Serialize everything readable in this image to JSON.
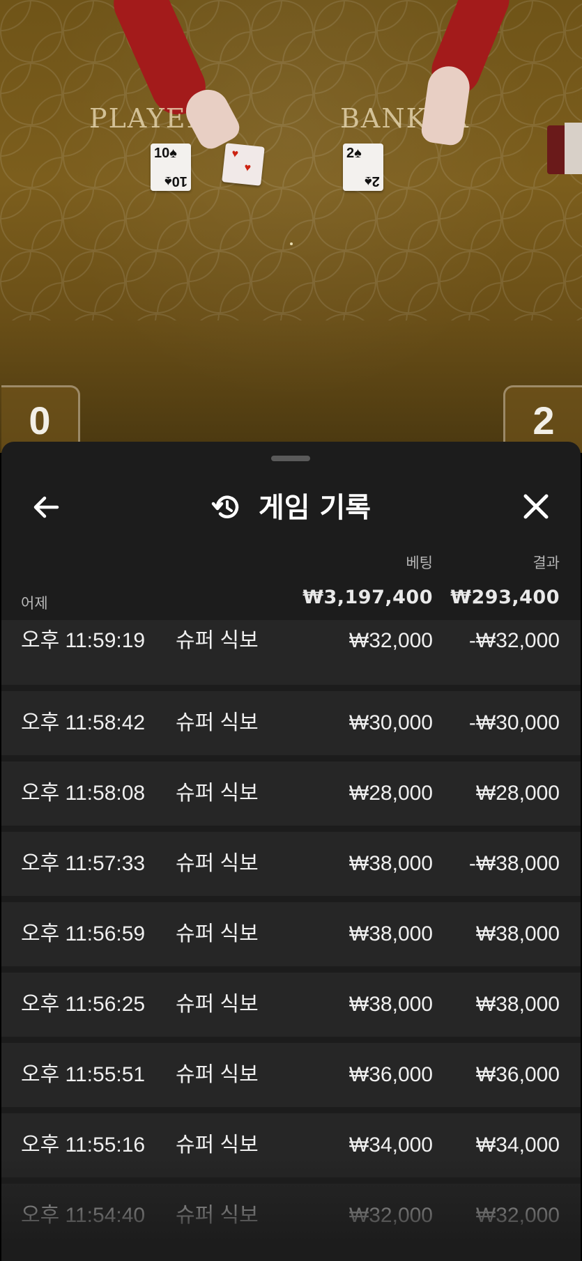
{
  "table": {
    "player_label": "PLAYER",
    "banker_label": "BANKER",
    "player_card": "10",
    "banker_card": "2",
    "player_score": "0",
    "banker_score": "2"
  },
  "sheet": {
    "title": "게임 기록",
    "column_headers": {
      "bet": "베팅",
      "result": "결과"
    },
    "day_label": "어제",
    "totals": {
      "bet": "₩3,197,400",
      "result": "₩293,400"
    },
    "rows": [
      {
        "time": "오후 11:59:19",
        "game": "슈퍼 식보",
        "bet": "₩32,000",
        "result": "-₩32,000"
      },
      {
        "time": "오후 11:58:42",
        "game": "슈퍼 식보",
        "bet": "₩30,000",
        "result": "-₩30,000"
      },
      {
        "time": "오후 11:58:08",
        "game": "슈퍼 식보",
        "bet": "₩28,000",
        "result": "₩28,000"
      },
      {
        "time": "오후 11:57:33",
        "game": "슈퍼 식보",
        "bet": "₩38,000",
        "result": "-₩38,000"
      },
      {
        "time": "오후 11:56:59",
        "game": "슈퍼 식보",
        "bet": "₩38,000",
        "result": "₩38,000"
      },
      {
        "time": "오후 11:56:25",
        "game": "슈퍼 식보",
        "bet": "₩38,000",
        "result": "₩38,000"
      },
      {
        "time": "오후 11:55:51",
        "game": "슈퍼 식보",
        "bet": "₩36,000",
        "result": "₩36,000"
      },
      {
        "time": "오후 11:55:16",
        "game": "슈퍼 식보",
        "bet": "₩34,000",
        "result": "₩34,000"
      },
      {
        "time": "오후 11:54:40",
        "game": "슈퍼 식보",
        "bet": "₩32,000",
        "result": "₩32,000"
      }
    ]
  },
  "icons": {
    "back": "arrow-left-icon",
    "history": "history-icon",
    "close": "close-icon"
  }
}
